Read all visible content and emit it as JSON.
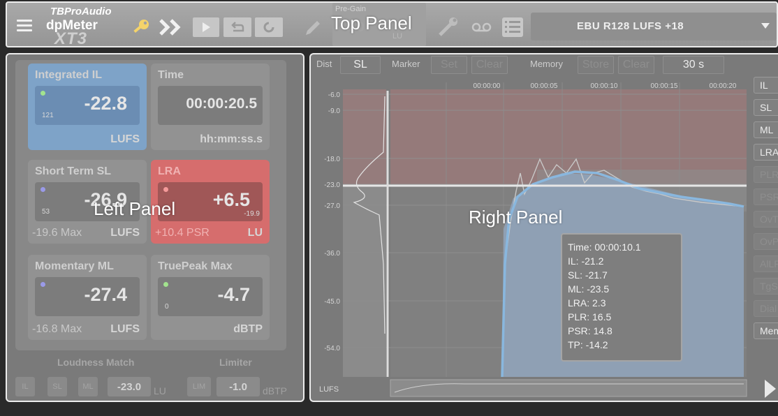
{
  "overlay": {
    "top": "Top Panel",
    "left": "Left Panel",
    "right": "Right Panel"
  },
  "top": {
    "logo": {
      "brand": "TBProAudio",
      "product": "dpMeter",
      "version": "XT3"
    },
    "icons": [
      "menu-icon",
      "key-icon",
      "double-chevron-icon",
      "play-icon",
      "undo-icon",
      "refresh-icon",
      "pencil-icon",
      "wrench-icon",
      "tape-icon",
      "list-icon"
    ],
    "pregain": {
      "label": "Pre-Gain",
      "value": "0.0",
      "unit": "LU"
    },
    "preset": "EBU R128 LUFS +18"
  },
  "left": {
    "tiles": {
      "integrated": {
        "title": "Integrated IL",
        "value": "-22.8",
        "small": "121",
        "unit": "LUFS",
        "dot": "#a2e38e",
        "bg": "#7ea3c8"
      },
      "time": {
        "title": "Time",
        "value": "00:00:20.5",
        "unit": "hh:mm:ss.s"
      },
      "short": {
        "title": "Short Term SL",
        "value": "-26.9",
        "small": "53",
        "extra": "-19.6 Max",
        "unit": "LUFS",
        "dot": "#9a9ae8"
      },
      "lra": {
        "title": "LRA",
        "value": "+6.5",
        "small2": "-19.9",
        "extra": "+10.4 PSR",
        "unit": "LU",
        "dot": "#f59a9a",
        "bg": "#d66d6d"
      },
      "momentary": {
        "title": "Momentary ML",
        "value": "-27.4",
        "extra": "-16.8 Max",
        "unit": "LUFS",
        "dot": "#9a9ae8"
      },
      "truepeak": {
        "title": "TruePeak Max",
        "value": "-4.7",
        "small": "0",
        "unit": "dBTP",
        "dot": "#a2e38e"
      }
    },
    "loudness_match": {
      "label": "Loudness Match",
      "buttons": [
        "IL",
        "SL",
        "ML"
      ],
      "value": "-23.0",
      "unit": "LU"
    },
    "limiter": {
      "label": "Limiter",
      "button": "LIM",
      "value": "-1.0",
      "unit": "dBTP"
    }
  },
  "right": {
    "header": {
      "dist_label": "Dist",
      "dist_value": "SL",
      "marker_label": "Marker",
      "marker_set": "Set",
      "marker_clear": "Clear",
      "memory_label": "Memory",
      "memory_store": "Store",
      "memory_clear": "Clear",
      "duration": "30 s"
    },
    "side_buttons": [
      {
        "label": "IL",
        "on": true
      },
      {
        "label": "SL",
        "on": true
      },
      {
        "label": "ML",
        "on": true
      },
      {
        "label": "LRA",
        "on": true
      },
      {
        "label": "PLR",
        "on": false
      },
      {
        "label": "PSR",
        "on": false
      },
      {
        "label": "OvTP",
        "on": false
      },
      {
        "label": "OvPk",
        "on": false
      },
      {
        "label": "AlLR",
        "on": false
      },
      {
        "label": "TgSt",
        "on": false
      },
      {
        "label": "Dial",
        "on": false
      },
      {
        "label": "Mem",
        "on": true
      }
    ],
    "time_labels": [
      "00:00:00",
      "00:00:05",
      "00:00:10",
      "00:00:15",
      "00:00:20"
    ],
    "level_labels": [
      "-6.0",
      "-9.0",
      "-18.0",
      "-23.0",
      "-27.0",
      "-36.0",
      "-45.0",
      "-54.0"
    ],
    "lufs_label": "LUFS",
    "tooltip": [
      "Time: 00:00:10.1",
      "IL: -21.2",
      "SL: -21.7",
      "ML: -23.5",
      "LRA: 2.3",
      "PLR: 16.5",
      "PSR: 14.8",
      "TP: -14.2"
    ]
  }
}
